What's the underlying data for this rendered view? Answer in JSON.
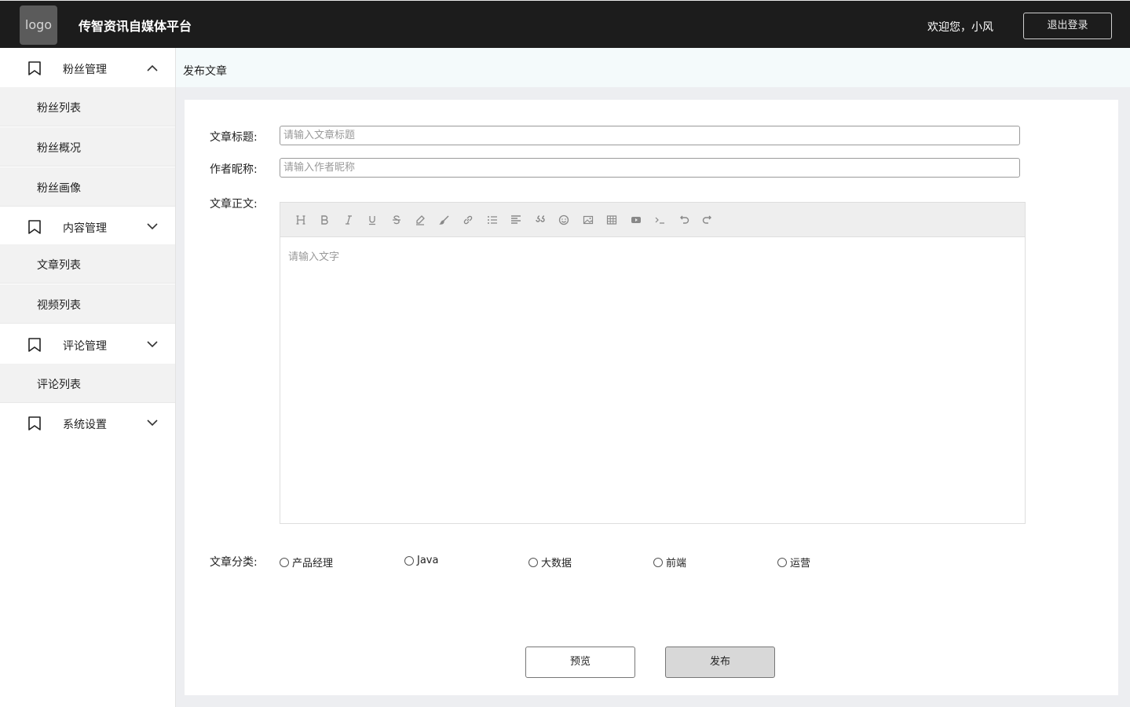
{
  "header": {
    "logo": "logo",
    "brand": "传智资讯自媒体平台",
    "welcome": "欢迎您，小风",
    "logout": "退出登录"
  },
  "sidebar": {
    "groups": [
      {
        "label": "粉丝管理",
        "expanded": true,
        "items": [
          "粉丝列表",
          "粉丝概况",
          "粉丝画像"
        ]
      },
      {
        "label": "内容管理",
        "expanded": false,
        "items": [
          "文章列表",
          "视频列表"
        ]
      },
      {
        "label": "评论管理",
        "expanded": false,
        "items": [
          "评论列表"
        ]
      },
      {
        "label": "系统设置",
        "expanded": false,
        "items": []
      }
    ]
  },
  "breadcrumb": "发布文章",
  "form": {
    "title_label": "文章标题:",
    "title_placeholder": "请输入文章标题",
    "author_label": "作者昵称:",
    "author_placeholder": "请输入作者昵称",
    "body_label": "文章正文:",
    "body_placeholder": "请输入文字",
    "category_label": "文章分类:",
    "categories": [
      "产品经理",
      "Java",
      "大数据",
      "前端",
      "运营"
    ]
  },
  "toolbar_icons": [
    "heading-icon",
    "bold-icon",
    "italic-icon",
    "underline-icon",
    "strikethrough-icon",
    "highlight-icon",
    "brush-icon",
    "link-icon",
    "list-icon",
    "align-icon",
    "quote-icon",
    "emoji-icon",
    "image-icon",
    "table-icon",
    "video-icon",
    "code-icon",
    "undo-icon",
    "redo-icon"
  ],
  "actions": {
    "preview": "预览",
    "publish": "发布"
  }
}
